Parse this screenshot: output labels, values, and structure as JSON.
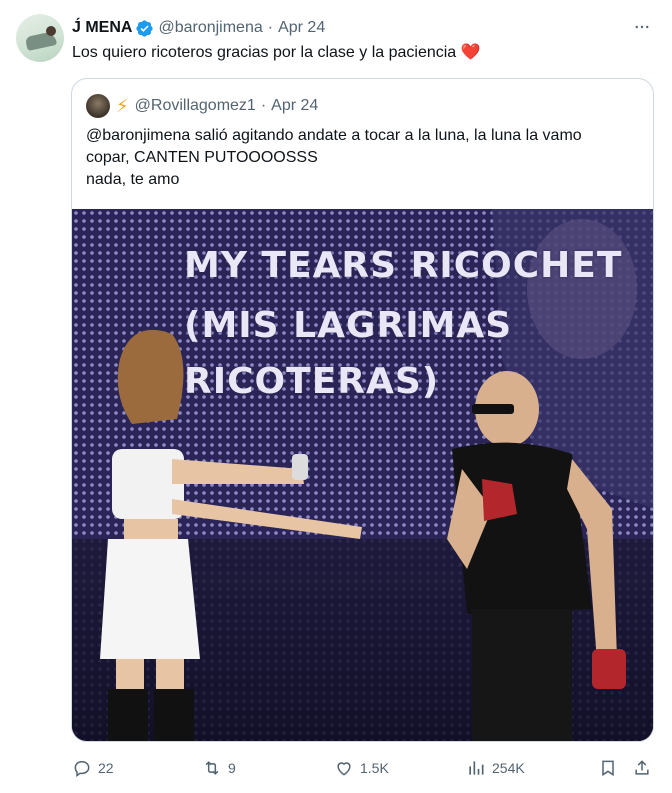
{
  "author": {
    "display_name": "J́ MENA",
    "handle": "@baronjimena",
    "separator": "·",
    "date": "Apr 24",
    "avatar_icon": "user-avatar-photo"
  },
  "tweet": {
    "text": "Los quiero ricoteros gracias por la clase y la paciencia",
    "emoji": "❤️"
  },
  "quote": {
    "bolt_emoji": "⚡",
    "handle": "@Rovillagomez1",
    "separator": "·",
    "date": "Apr 24",
    "lines": [
      "@baronjimena salió agitando andate a tocar a la luna, la luna la vamo",
      "copar, CANTEN PUTOOOOSSS",
      "nada, te amo"
    ],
    "image": {
      "caption_lines": [
        "MY TEARS RICOCHET",
        "(MIS LAGRIMAS",
        "RICOTERAS)"
      ]
    }
  },
  "actions": {
    "replies": "22",
    "reposts": "9",
    "likes": "1.5K",
    "views": "254K",
    "icons": [
      "reply-icon",
      "repost-icon",
      "like-icon",
      "views-icon",
      "bookmark-icon",
      "share-icon"
    ]
  },
  "colors": {
    "verified": "#1d9bf0",
    "secondary_text": "#536471",
    "border": "#cfd9de",
    "heart": "#e0245e"
  }
}
